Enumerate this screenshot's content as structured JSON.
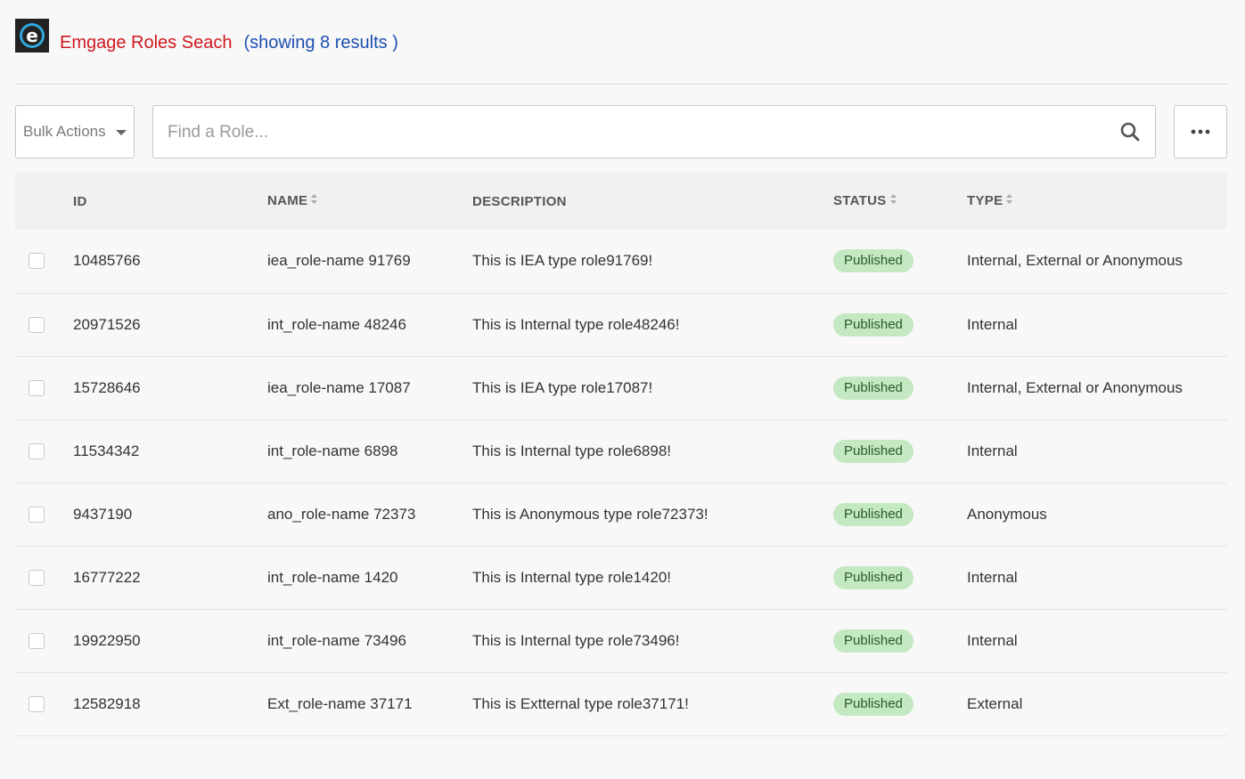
{
  "header": {
    "title": "Emgage Roles Seach",
    "count_text": "(showing 8 results )"
  },
  "toolbar": {
    "bulk_actions_label": "Bulk Actions",
    "search_placeholder": "Find a Role..."
  },
  "table": {
    "columns": [
      "ID",
      "NAME",
      "DESCRIPTION",
      "STATUS",
      "TYPE"
    ],
    "rows": [
      {
        "id": "10485766",
        "name": "iea_role-name 91769",
        "description": "This is IEA type role91769!",
        "status": "Published",
        "type": "Internal, External or Anonymous"
      },
      {
        "id": "20971526",
        "name": "int_role-name 48246",
        "description": "This is Internal type role48246!",
        "status": "Published",
        "type": "Internal"
      },
      {
        "id": "15728646",
        "name": "iea_role-name 17087",
        "description": "This is IEA type role17087!",
        "status": "Published",
        "type": "Internal, External or Anonymous"
      },
      {
        "id": "11534342",
        "name": "int_role-name 6898",
        "description": "This is Internal type role6898!",
        "status": "Published",
        "type": "Internal"
      },
      {
        "id": "9437190",
        "name": "ano_role-name 72373",
        "description": "This is Anonymous type role72373!",
        "status": "Published",
        "type": "Anonymous"
      },
      {
        "id": "16777222",
        "name": "int_role-name 1420",
        "description": "This is Internal type role1420!",
        "status": "Published",
        "type": "Internal"
      },
      {
        "id": "19922950",
        "name": "int_role-name 73496",
        "description": "This is Internal type role73496!",
        "status": "Published",
        "type": "Internal"
      },
      {
        "id": "12582918",
        "name": "Ext_role-name 37171",
        "description": "This is Extternal type role37171!",
        "status": "Published",
        "type": "External"
      }
    ]
  },
  "icons": {
    "logo": "emgage-logo-icon",
    "search": "search-icon",
    "more": "more-horizontal-icon",
    "sort": "sort-icon",
    "dropdown": "caret-down-icon"
  },
  "colors": {
    "title": "#d0181f",
    "count": "#1d4fae",
    "badge_bg": "#c4e8c1",
    "badge_text": "#2b5a2a",
    "logo_ring": "#2fa8dc"
  }
}
